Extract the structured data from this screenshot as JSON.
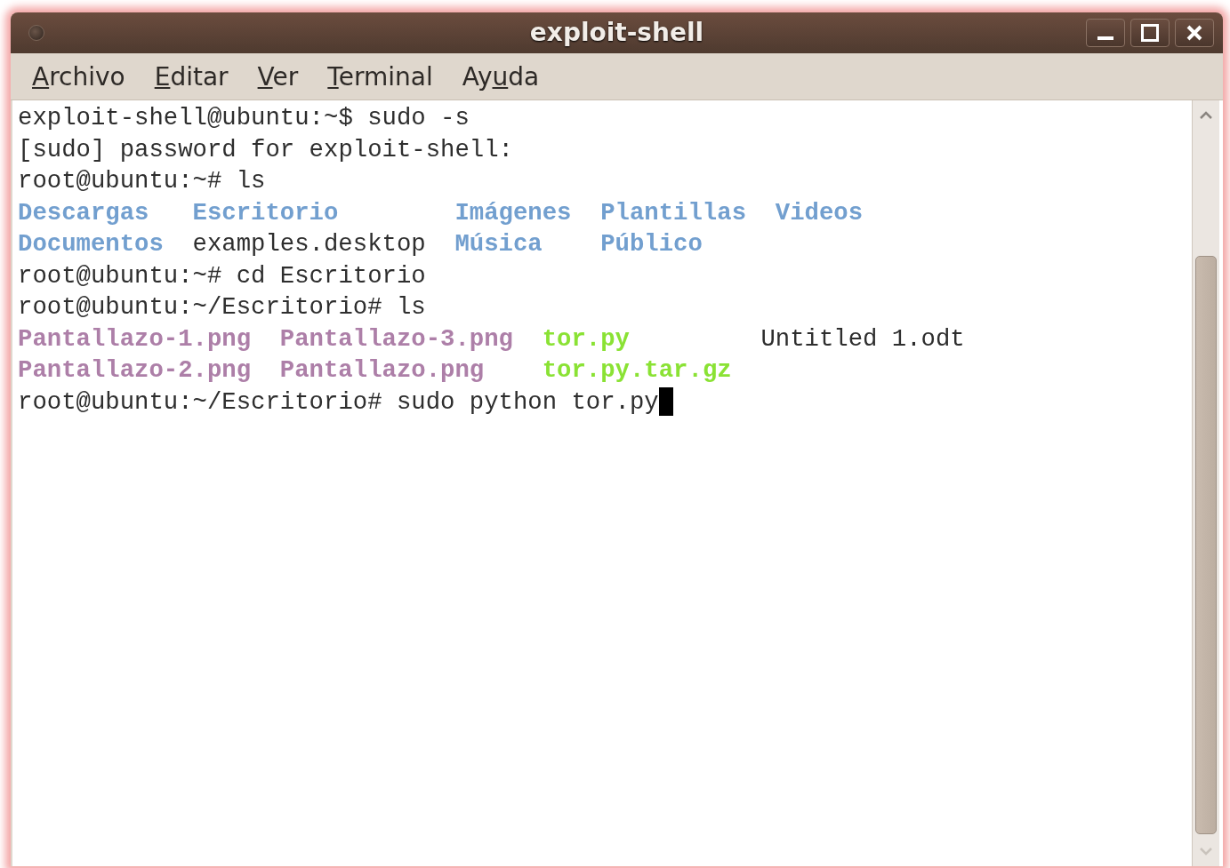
{
  "window": {
    "title": "exploit-shell"
  },
  "menu": [
    {
      "key": "A",
      "post": "rchivo"
    },
    {
      "key": "E",
      "post": "ditar"
    },
    {
      "key": "V",
      "post": "er"
    },
    {
      "key": "T",
      "post": "erminal"
    },
    {
      "pre": "Ay",
      "key": "u",
      "post": "da"
    }
  ],
  "terminal": {
    "lines": [
      {
        "kind": "text",
        "text": "exploit-shell@ubuntu:~$ sudo -s",
        "cursor": false
      },
      {
        "kind": "text",
        "text": "[sudo] password for exploit-shell:",
        "cursor": false
      },
      {
        "kind": "text",
        "text": "root@ubuntu:~# ls",
        "cursor": false
      },
      {
        "kind": "listing",
        "rows": [
          [
            {
              "name": "Descargas",
              "kind": "dir"
            },
            {
              "name": "Escritorio",
              "kind": "dir"
            },
            {
              "name": "Imágenes",
              "kind": "dir"
            },
            {
              "name": "Plantillas",
              "kind": "dir"
            },
            {
              "name": "Videos",
              "kind": "dir"
            }
          ],
          [
            {
              "name": "Documentos",
              "kind": "dir"
            },
            {
              "name": "examples.desktop",
              "kind": "file"
            },
            {
              "name": "Música",
              "kind": "dir"
            },
            {
              "name": "Público",
              "kind": "dir"
            }
          ]
        ]
      },
      {
        "kind": "text",
        "text": "root@ubuntu:~# cd Escritorio",
        "cursor": false
      },
      {
        "kind": "text",
        "text": "root@ubuntu:~/Escritorio# ls",
        "cursor": false
      },
      {
        "kind": "listing",
        "rows": [
          [
            {
              "name": "Pantallazo-1.png",
              "kind": "image"
            },
            {
              "name": "Pantallazo-3.png",
              "kind": "image"
            },
            {
              "name": "tor.py",
              "kind": "exec"
            },
            {
              "name": "Untitled 1.odt",
              "kind": "file"
            }
          ],
          [
            {
              "name": "Pantallazo-2.png",
              "kind": "image"
            },
            {
              "name": "Pantallazo.png",
              "kind": "image"
            },
            {
              "name": "tor.py.tar.gz",
              "kind": "exec"
            }
          ]
        ]
      },
      {
        "kind": "text",
        "text": "root@ubuntu:~/Escritorio# sudo python tor.py",
        "cursor": true
      }
    ]
  }
}
